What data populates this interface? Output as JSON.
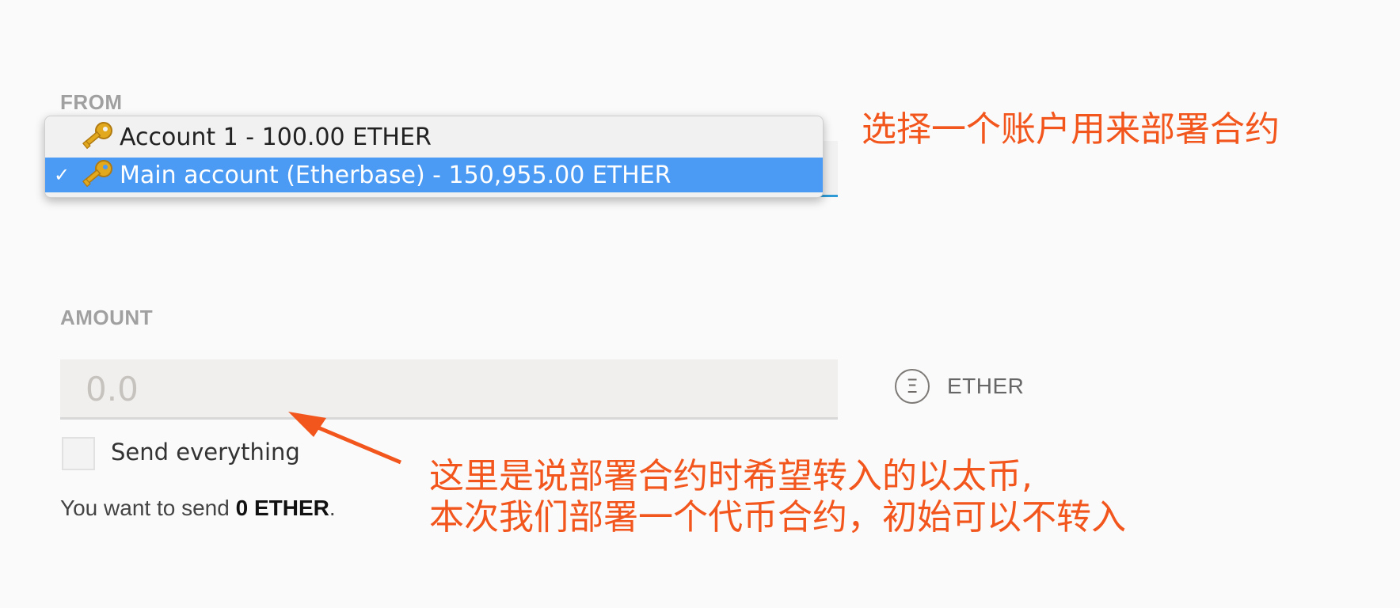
{
  "from": {
    "label": "FROM",
    "options": [
      {
        "name": "Account 1 - 100.00 ETHER",
        "selected": false
      },
      {
        "name": "Main account (Etherbase) - 150,955.00 ETHER",
        "selected": true
      }
    ],
    "check_mark": "✓",
    "icon": "key-icon"
  },
  "amount": {
    "label": "AMOUNT",
    "placeholder": "0.0",
    "value": "",
    "unit_symbol": "Ξ",
    "unit": "ETHER",
    "unit_icon": "ether-icon"
  },
  "send_everything": {
    "label": "Send everything",
    "checked": false
  },
  "summary": {
    "prefix": "You want to send ",
    "amount": "0 ETHER",
    "suffix": "."
  },
  "annotations": {
    "top": "选择一个账户用来部署合约",
    "bottom_line1": "这里是说部署合约时希望转入的以太币,",
    "bottom_line2": "本次我们部署一个代币合约，初始可以不转入",
    "color": "#f2561d"
  },
  "colors": {
    "accent": "#2e9bd6",
    "selected_option": "#4b9af3",
    "annotation": "#f2561d"
  }
}
